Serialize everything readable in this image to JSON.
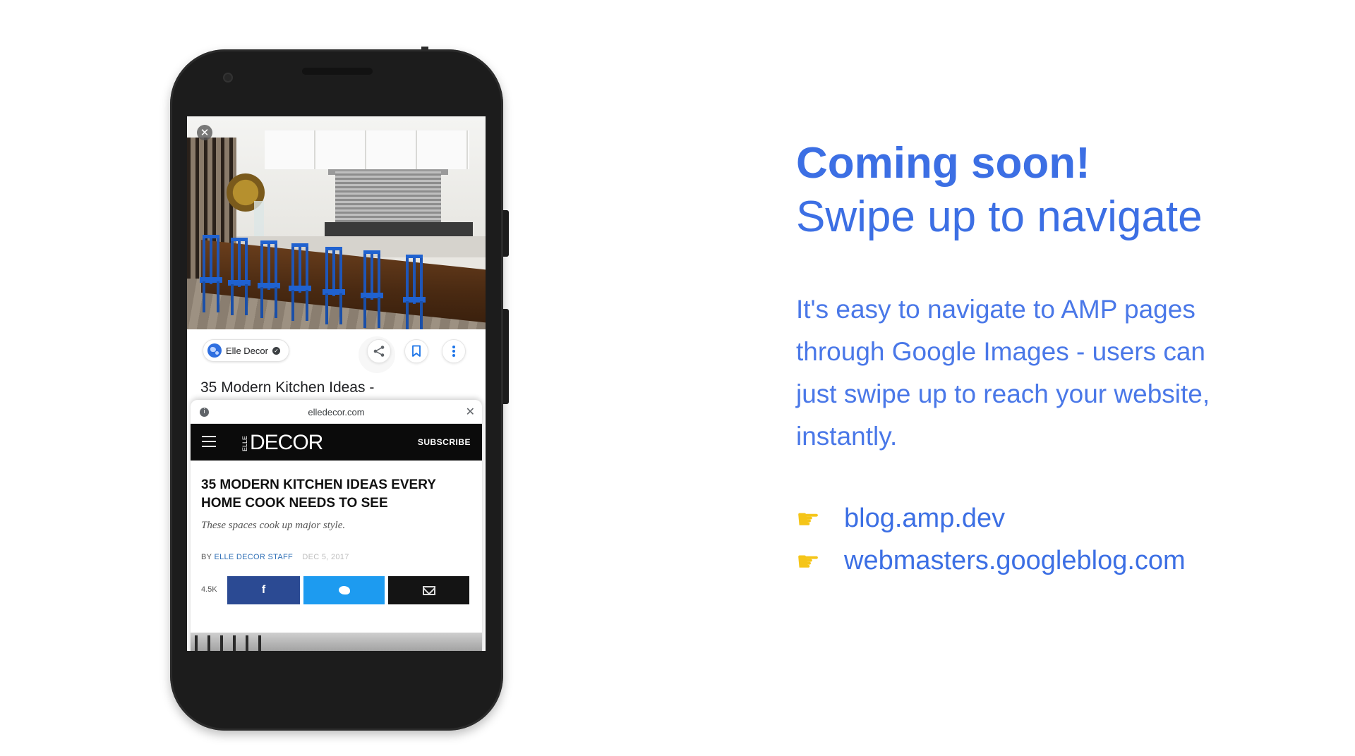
{
  "hero_image": {
    "alt": "kitchen-with-blue-chairs",
    "close_symbol": "✕"
  },
  "source": {
    "name": "Elle Decor",
    "verified_symbol": "✓"
  },
  "result_title": "35 Modern Kitchen Ideas -",
  "amp_viewer": {
    "domain": "elledecor.com",
    "info_symbol": "i",
    "close_symbol": "✕"
  },
  "site": {
    "logo_small": "ELLE",
    "logo": "DECOR",
    "subscribe_label": "SUBSCRIBE",
    "article_title": "35 MODERN KITCHEN IDEAS EVERY HOME COOK NEEDS TO SEE",
    "article_subtitle": "These spaces cook up major style.",
    "byline_prefix": "BY",
    "byline_author": "ELLE DECOR STAFF",
    "byline_date": "DEC 5, 2017",
    "share_count": "4.5K",
    "facebook_label": "f"
  },
  "slide": {
    "headline": "Coming soon!",
    "subheadline": "Swipe up to navigate",
    "body_lines": [
      "It's easy to navigate to AMP pages",
      "through Google Images - users can",
      "just swipe up to reach your website,",
      "instantly."
    ],
    "links": [
      {
        "icon": "backhand-index-pointing-right-icon",
        "text": "blog.amp.dev"
      },
      {
        "icon": "backhand-index-pointing-right-icon",
        "text": "webmasters.googleblog.com"
      }
    ]
  },
  "colors": {
    "accent": "#3c6fe4",
    "body_text": "#4a78e8"
  }
}
